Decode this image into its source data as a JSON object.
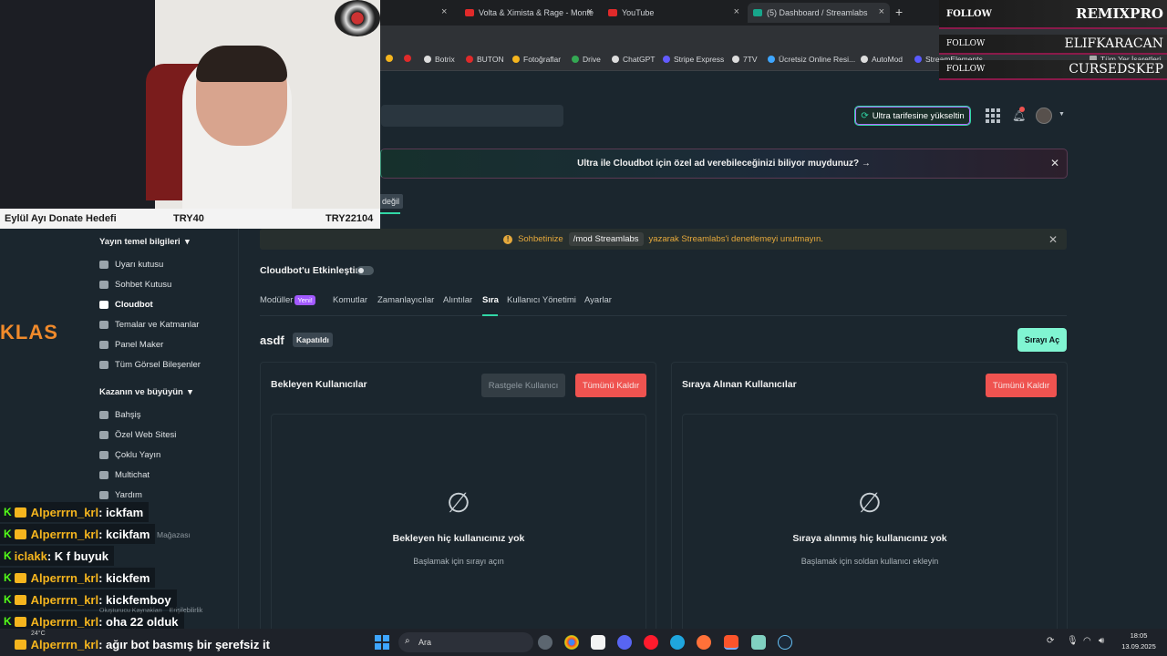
{
  "browser": {
    "tabs": [
      {
        "label": "Volta & Ximista & Rage - Monte",
        "active": false
      },
      {
        "label": "YouTube",
        "active": false
      },
      {
        "label": "(5) Dashboard / Streamlabs",
        "active": true
      }
    ],
    "close_glyph": "×",
    "new_tab_glyph": "+",
    "bookmarks": [
      "Botrix",
      "BUTON",
      "Fotoğraflar",
      "Drive",
      "ChatGPT",
      "Stripe Express",
      "7TV",
      "Ücretsiz Online Resi...",
      "AutoMod",
      "StreamElements",
      "Tüm Yer İşaretleri"
    ]
  },
  "header": {
    "upgrade_label": "Ultra tarifesine yükseltin",
    "notification_count": "5"
  },
  "promo": {
    "text": "Ultra ile Cloudbot için özel ad verebileceğinizi biliyor muydunuz? →",
    "close_glyph": "✕"
  },
  "partial_tab_label": "değil",
  "notice": {
    "prefix": "Sohbetinize",
    "code": "/mod Streamlabs",
    "suffix": "yazarak Streamlabs'i denetlemeyi unutmayın.",
    "close_glyph": "✕"
  },
  "sidebar": {
    "section1": "Yayın temel bilgileri",
    "items1": [
      {
        "label": "Uyarı kutusu",
        "icon": "bell-icon"
      },
      {
        "label": "Sohbet Kutusu",
        "icon": "chat-icon"
      },
      {
        "label": "Cloudbot",
        "icon": "bot-icon",
        "active": true
      },
      {
        "label": "Temalar ve Katmanlar",
        "icon": "layers-icon"
      },
      {
        "label": "Panel Maker",
        "icon": "panel-icon"
      },
      {
        "label": "Tüm Görsel Bileşenler",
        "icon": "widgets-icon"
      }
    ],
    "section2": "Kazanın ve büyüyün",
    "items2": [
      {
        "label": "Bahşiş",
        "icon": "tip-icon"
      },
      {
        "label": "Özel Web Sitesi",
        "icon": "website-icon"
      },
      {
        "label": "Çoklu Yayın",
        "icon": "multistream-icon"
      },
      {
        "label": "Multichat",
        "icon": "multichat-icon"
      },
      {
        "label": "Yardım",
        "icon": "help-icon"
      }
    ],
    "store_label": "Mağazası",
    "footer_left": "Oluşturucu Kaynakları",
    "footer_right": "Erişilebilirlik",
    "overlay_text": "KLAS"
  },
  "cloudbot": {
    "enable_label": "Cloudbot'u Etkinleştir",
    "tabs": [
      {
        "label": "Modüller",
        "badge": "Yeni!"
      },
      {
        "label": "Komutlar"
      },
      {
        "label": "Zamanlayıcılar"
      },
      {
        "label": "Alıntılar"
      },
      {
        "label": "Sıra",
        "active": true
      },
      {
        "label": "Kullanıcı Yönetimi"
      },
      {
        "label": "Ayarlar"
      }
    ],
    "queue_name": "asdf",
    "queue_status": "Kapatıldı",
    "open_queue_label": "Sırayı Aç",
    "waiting": {
      "title": "Bekleyen Kullanıcılar",
      "random_label": "Rastgele Kullanıcı",
      "remove_all_label": "Tümünü Kaldır",
      "empty_title": "Bekleyen hiç kullanıcınız yok",
      "empty_sub": "Başlamak için sırayı açın"
    },
    "picked": {
      "title": "Sıraya Alınan Kullanıcılar",
      "remove_all_label": "Tümünü Kaldır",
      "empty_title": "Sıraya alınmış hiç kullanıcınız yok",
      "empty_sub": "Başlamak için soldan kullanıcı ekleyin"
    },
    "empty_glyph": "∅"
  },
  "stream": {
    "donate_label": "Eylül Ayı Donate Hedefi",
    "donate_current": "TRY40",
    "donate_goal": "TRY22104",
    "follows": [
      {
        "label": "FOLLOW",
        "name": "REMIXPRO"
      },
      {
        "label": "FOLLOW",
        "name": "ELIFKARACAN"
      },
      {
        "label": "FOLLOW",
        "name": "CURSEDSKEP"
      }
    ],
    "chat_badge": "K",
    "chat": [
      {
        "user": "Alperrrn_krl",
        "msg": ": ickfam"
      },
      {
        "user": "Alperrrn_krl",
        "msg": ": kcikfam"
      },
      {
        "user": "iclakk",
        "msg": ": K f buyuk"
      },
      {
        "user": "Alperrrn_krl",
        "msg": ": kickfem"
      },
      {
        "user": "Alperrrn_krl",
        "msg": ": kickfemboy"
      },
      {
        "user": "Alperrrn_krl",
        "msg": ": oha 22 olduk"
      },
      {
        "user": "Alperrrn_krl",
        "msg": ": ağır bot basmış bir şerefsiz it"
      }
    ]
  },
  "taskbar": {
    "search_placeholder": "Ara",
    "time": "18:05",
    "date": "13.09.2025",
    "temperature": "24°C"
  }
}
